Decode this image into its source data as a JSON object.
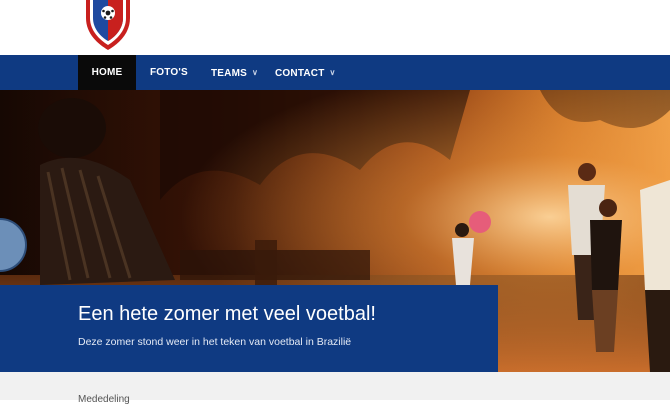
{
  "header": {
    "logo_icon": "club-crest-icon"
  },
  "nav": {
    "items": [
      {
        "label": "HOME",
        "active": true
      },
      {
        "label": "FOTO'S",
        "active": false
      },
      {
        "label": "TEAMS",
        "active": false,
        "has_dropdown": true
      },
      {
        "label": "CONTACT",
        "active": false,
        "has_dropdown": true
      }
    ],
    "dropdown_icon": "chevron-down-icon"
  },
  "hero": {
    "image": "kids-playing-football-at-sunset",
    "title": "Een hete zomer met veel voetbal!",
    "subtitle": "Deze zomer stond weer in het teken van voetbal in Braziliё"
  },
  "content": {
    "section_label": "Mededeling"
  },
  "colors": {
    "brand_blue": "#0f3a82",
    "nav_active": "#0a0a0a",
    "crest_red": "#c8201e",
    "background_gray": "#f1f1f1"
  }
}
